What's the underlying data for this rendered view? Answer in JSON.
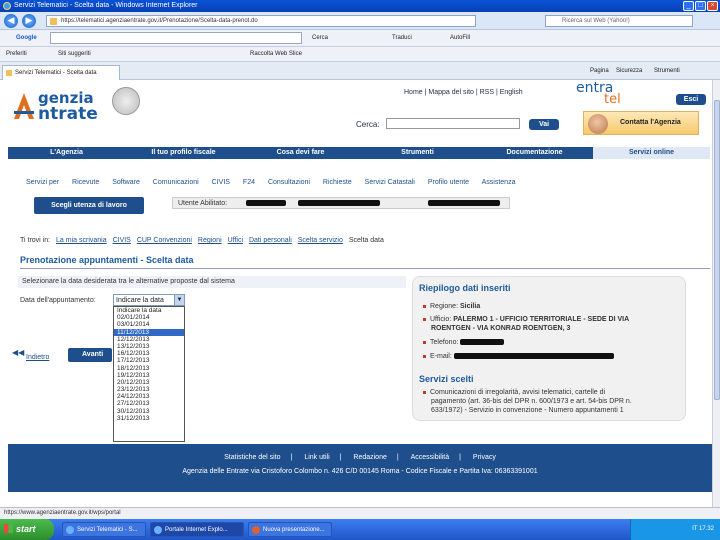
{
  "window": {
    "title": "Servizi Telematici - Scelta data - Windows Internet Explorer",
    "minimize": "_",
    "maximize": "□",
    "close": "×"
  },
  "browser": {
    "back": "◀",
    "forward": "▶",
    "url": "https://telematici.agenziaentrate.gov.it/Prenotazione/Scelta-data-prenot.do",
    "search_placeholder": "Ricerca sul Web (Yahoo!)",
    "google_label": "Google",
    "menu_items": [
      "Cerca",
      "Traduci",
      "AutoFill"
    ],
    "favorites": [
      "Preferiti",
      "Siti suggeriti",
      "Raccolta Web Slice"
    ],
    "tab_label": "Servizi Telematici - Scelta data",
    "right_tools": [
      "Pagina",
      "Sicurezza",
      "Strumenti"
    ]
  },
  "header": {
    "logo_line1": "genzia",
    "logo_line2": "ntrate",
    "toplinks": "Home  |  Mappa del sito  |  RSS  |  English",
    "search_label": "Cerca:",
    "search_value": "",
    "search_button": "Vai",
    "entratel_a": "entra",
    "entratel_b": "tel",
    "esci": "Esci",
    "contatta": "Contatta l'Agenzia"
  },
  "mainnav": [
    {
      "label": "L'Agenzia",
      "active": false
    },
    {
      "label": "Il tuo profilo fiscale",
      "active": false
    },
    {
      "label": "Cosa devi fare",
      "active": false
    },
    {
      "label": "Strumenti",
      "active": false
    },
    {
      "label": "Documentazione",
      "active": false
    },
    {
      "label": "Servizi online",
      "active": true
    }
  ],
  "subnav": [
    "Servizi per",
    "Ricevute",
    "Software",
    "Comunicazioni",
    "CIVIS",
    "F24",
    "Consultazioni",
    "Richieste",
    "Servizi Catastali",
    "Profilo utente",
    "Assistenza"
  ],
  "utenza": {
    "button": "Scegli utenza di lavoro",
    "info": "Utente Abilitato: "
  },
  "breadcrumb": {
    "prefix": "Ti trovi in:",
    "items": [
      "La mia scrivania",
      "CIVIS",
      "CUP Convenzioni",
      "Regioni",
      "Uffici",
      "Dati personali",
      "Scelta servizio"
    ],
    "current": "Scelta data"
  },
  "page_title": "Prenotazione appuntamenti - Scelta data",
  "form": {
    "instruction": "Selezionare la data desiderata tra le alternative proposte dal sistema",
    "date_label": "Data dell'appuntamento:",
    "selected": "Indicare la data",
    "options": [
      "Indicare la data",
      "02/01/2014",
      "03/01/2014",
      "11/12/2013",
      "12/12/2013",
      "13/12/2013",
      "16/12/2013",
      "17/12/2013",
      "18/12/2013",
      "19/12/2013",
      "20/12/2013",
      "23/12/2013",
      "24/12/2013",
      "27/12/2013",
      "30/12/2013",
      "31/12/2013"
    ],
    "highlighted_index": 3,
    "back_link": "Indietro",
    "next_button": "Avanti"
  },
  "riepilogo": {
    "title": "Riepilogo dati inseriti",
    "regione_label": "Regione:",
    "regione_value": "Sicilia",
    "ufficio_label": "Ufficio:",
    "ufficio_value_line1": "PALERMO 1 - UFFICIO TERRITORIALE - SEDE DI VIA",
    "ufficio_value_line2": "ROENTGEN - VIA KONRAD ROENTGEN, 3",
    "telefono_label": "Telefono:",
    "email_label": "E-mail:",
    "servizi_title": "Servizi scelti",
    "servizi_line1": "Comunicazioni di irregolarità, avvisi telematici, cartelle di",
    "servizi_line2": "pagamento (art. 36-bis del DPR n. 600/1973 e art. 54-bis DPR n.",
    "servizi_line3": "633/1972) - Servizio in convenzione - Numero appuntamenti 1"
  },
  "footer": {
    "links": [
      "Statistiche del sito",
      "Link utili",
      "Redazione",
      "Accessibilità",
      "Privacy"
    ],
    "address": "Agenzia delle Entrate via Cristoforo Colombo n. 426 C/D 00145 Roma - Codice Fiscale e Partita Iva: 06363391001"
  },
  "statusbar": "https://www.agenziaentrate.gov.it/wps/portal",
  "taskbar": {
    "start": "start",
    "tasks": [
      "Servizi Telematici - S...",
      "Portale Internet Explo...",
      "Nuova presentazione..."
    ],
    "clock": "IT  17.32"
  },
  "colors": {
    "brand_blue": "#1e4f8c",
    "title_blue": "#1d5a9e",
    "orange": "#e07020"
  }
}
